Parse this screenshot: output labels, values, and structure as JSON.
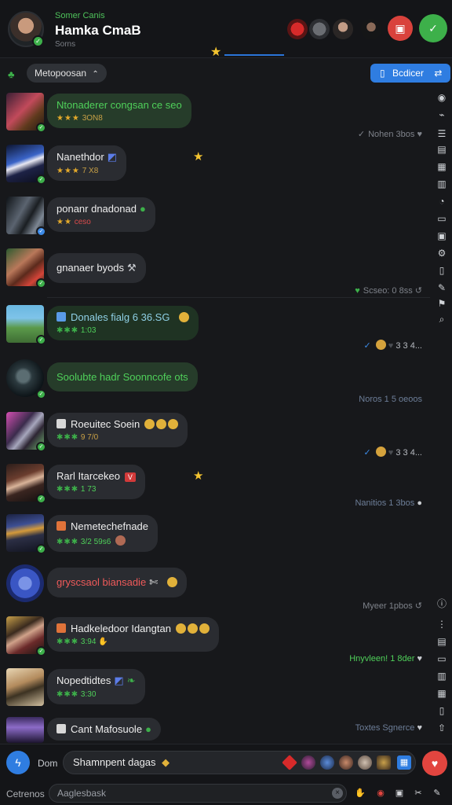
{
  "header": {
    "subtitle": "Somer Canis",
    "title": "Hamka CmaB",
    "status": "Sorns",
    "colors": {
      "accent_green": "#3db04a",
      "accent_blue": "#2f7de1",
      "accent_red": "#e2453f"
    },
    "participants": [
      "avatar-red",
      "avatar-grey",
      "avatar-man",
      "avatar-dark"
    ],
    "icons": [
      "calendar-icon",
      "check-icon"
    ]
  },
  "filter": {
    "chip_label": "Metopoosan",
    "chip_caret": "⌃",
    "button_label": "Bcdicer",
    "button_icon": "document-icon",
    "button_trailing_icon": "shuffle-icon"
  },
  "messages": [
    {
      "text": "Ntonaderer congsan ce seo",
      "rating": "★★★",
      "value": "3ON8",
      "style": "green",
      "meta": "Nohen  3bos"
    },
    {
      "text": "Nanethdor",
      "trailing": "◩",
      "rating": "★★★",
      "value": "7 X8",
      "style": "plain"
    },
    {
      "text": "ponanr dnadonad",
      "trailing": "●",
      "rating": "★★",
      "value": "ceso",
      "style": "plain"
    },
    {
      "text": "gnanaer byods",
      "trailing": "⚒",
      "style": "plain",
      "meta": "Scseo:  0 8ss"
    },
    {
      "text": "Donales fialg 6 36.SG",
      "rating": "✱✱✱",
      "value": "1:03",
      "style": "greenish",
      "meta": "3 3  4..."
    },
    {
      "text": "Soolubte hadr Soonncofe ots",
      "style": "green",
      "meta": "Noros  1 5 oeoos"
    },
    {
      "text": "Roeuitec Soein",
      "rating": "✱✱✱",
      "value": "9 7/0",
      "style": "plain",
      "meta": "3 3  4..."
    },
    {
      "text": "Rarl Itarcekeo",
      "rating": "✱✱✱",
      "value": "1 73",
      "style": "plain",
      "meta": "Nanitios  1 3bos"
    },
    {
      "text": "Nemetechefnade",
      "rating": "✱✱✱",
      "value": "3/2  59s6",
      "style": "plain"
    },
    {
      "text": "gryscsaol biansadie",
      "trailing": "✄",
      "style": "plain",
      "meta": "Myeer  1pbos"
    },
    {
      "text": "Hadkeledoor Idangtan",
      "rating": "✱✱✱",
      "value": "3:94",
      "style": "plain",
      "meta": "Hnyvleen!  1 8der"
    },
    {
      "text": "Nopedtidtes",
      "trailing": "◩",
      "rating": "✱✱✱",
      "value": "3:30",
      "style": "plain"
    },
    {
      "text": "Cant Mafosuole",
      "trailing": "●",
      "style": "plain",
      "meta": "Toxtes  Sgnerce"
    }
  ],
  "composer": {
    "label": "Dom",
    "input_value": "Shamnpent dagas",
    "input_emoji": "◆",
    "label2": "Cetrenos",
    "search_placeholder": "Aaglesbask",
    "send_icon": "heart-icon"
  }
}
